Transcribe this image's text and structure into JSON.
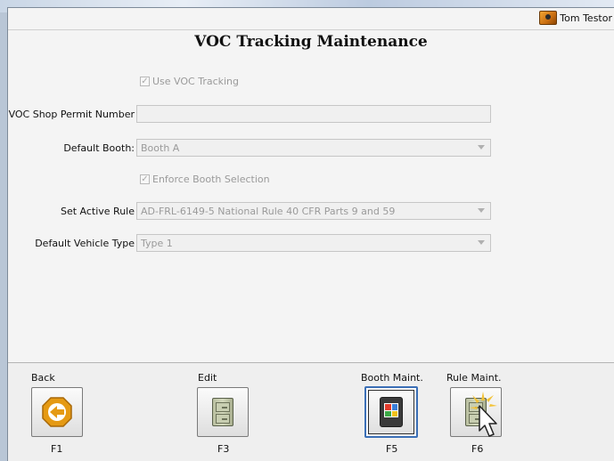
{
  "header": {
    "user_name": "Tom Testor",
    "title": "VOC Tracking Maintenance"
  },
  "form": {
    "use_voc_tracking": {
      "label": "Use VOC Tracking",
      "checked": true
    },
    "permit_number": {
      "label": "VOC Shop Permit Number",
      "value": ""
    },
    "default_booth": {
      "label": "Default Booth:",
      "value": "Booth A"
    },
    "enforce_booth_selection": {
      "label": "Enforce Booth Selection",
      "checked": true
    },
    "active_rule": {
      "label": "Set Active Rule",
      "value": "AD-FRL-6149-5 National Rule 40 CFR Parts 9 and 59"
    },
    "vehicle_type": {
      "label": "Default Vehicle Type",
      "value": "Type 1"
    }
  },
  "function_keys": [
    {
      "label": "Back",
      "key": "F1",
      "icon": "back-arrow-icon"
    },
    {
      "label": "Edit",
      "key": "F3",
      "icon": "file-cabinet-icon"
    },
    {
      "label": "Booth Maint.",
      "key": "F5",
      "icon": "paint-booth-icon"
    },
    {
      "label": "Rule Maint.",
      "key": "F6",
      "icon": "file-cabinet-icon"
    }
  ],
  "colors": {
    "back_icon_fill": "#e59a14",
    "active_button_border": "#3b6fb6"
  }
}
